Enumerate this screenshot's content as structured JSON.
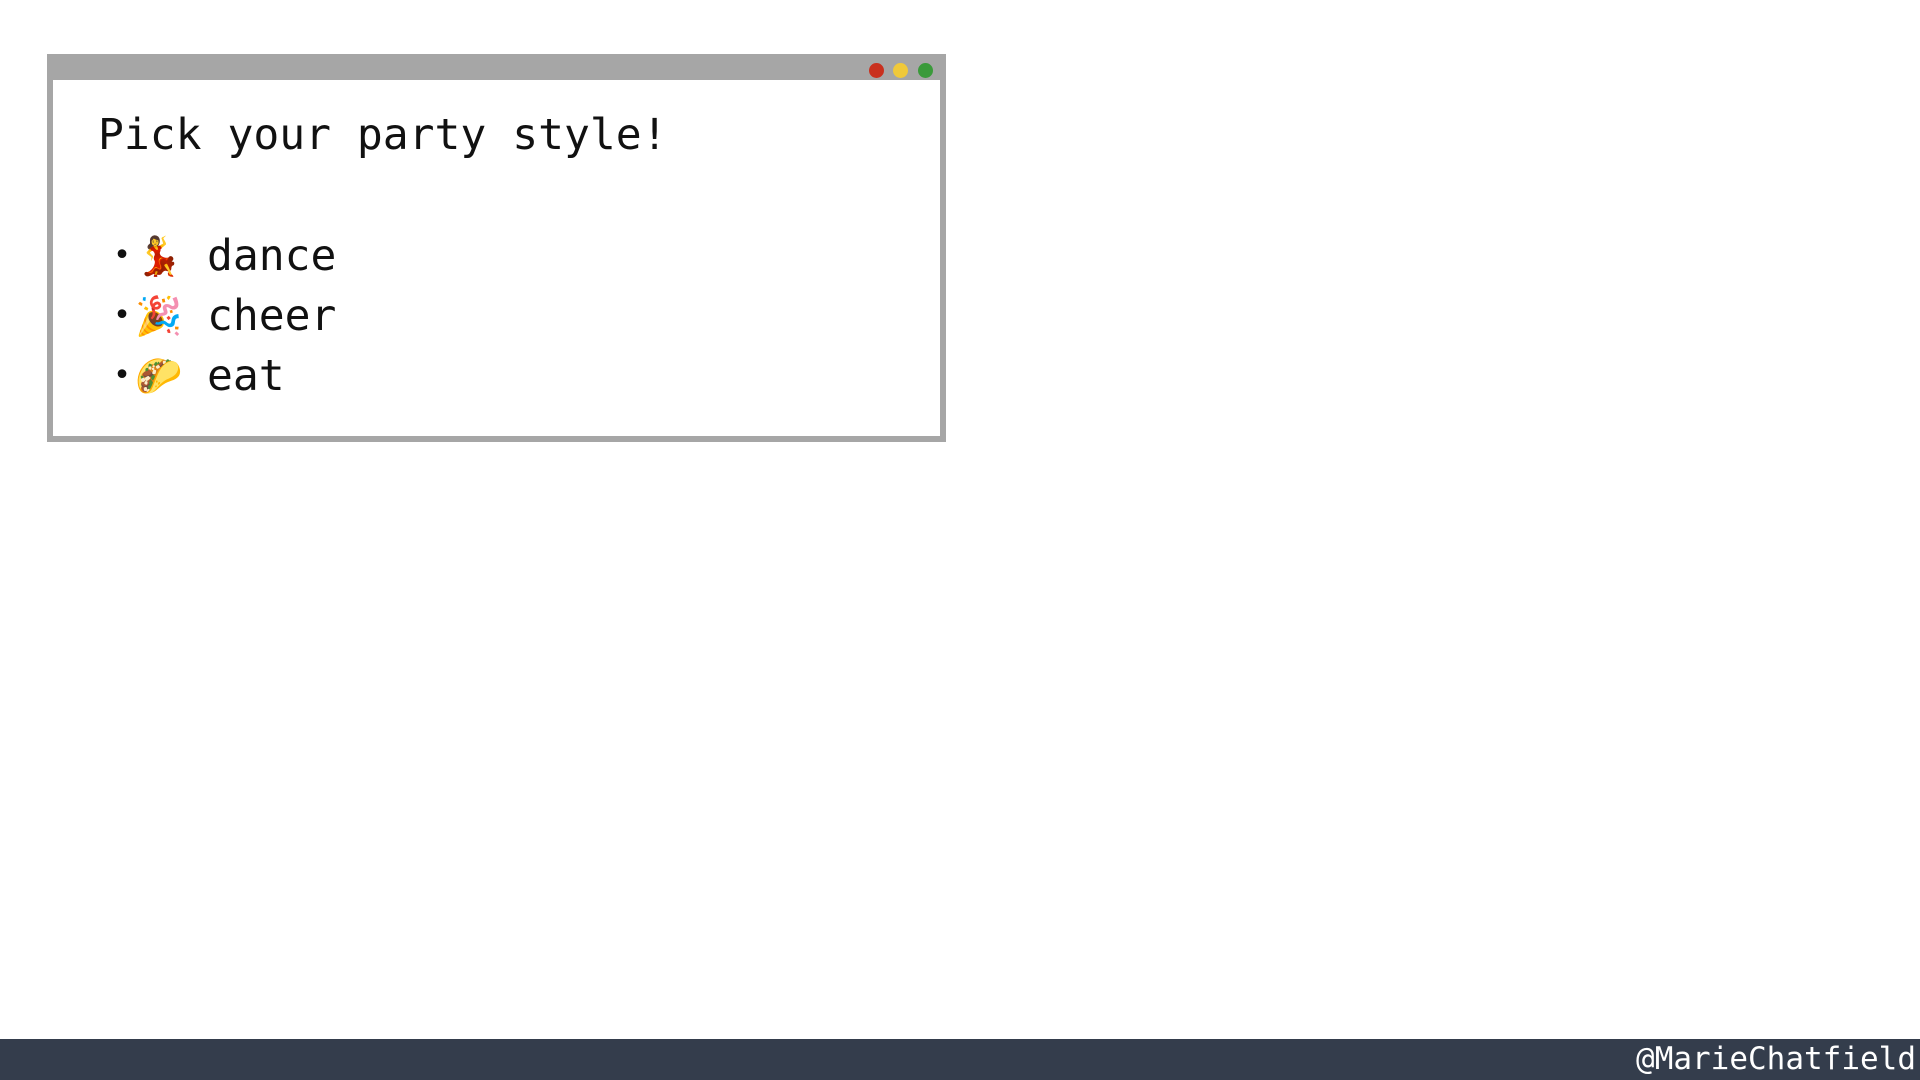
{
  "window": {
    "heading": "Pick your party style!",
    "controls": {
      "close_color": "#c9301e",
      "minimize_color": "#f0c93a",
      "maximize_color": "#3a9a3a"
    }
  },
  "options": [
    {
      "bullet": "•",
      "icon": "flamenco-dancer-icon",
      "emoji": "💃",
      "label": "dance"
    },
    {
      "bullet": "•",
      "icon": "party-popper-icon",
      "emoji": "🎉",
      "label": "cheer"
    },
    {
      "bullet": "•",
      "icon": "taco-icon",
      "emoji": "🌮",
      "label": "eat"
    }
  ],
  "footer": {
    "handle": "@MarieChatfield",
    "background_color": "#343d4c"
  }
}
